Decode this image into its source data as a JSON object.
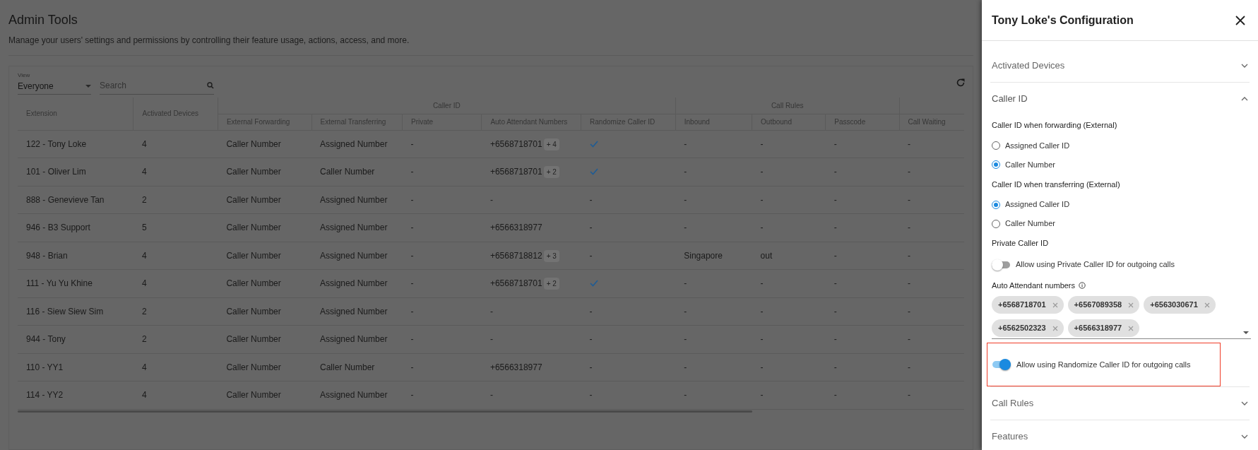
{
  "page": {
    "title": "Admin Tools",
    "subtitle": "Manage your users' settings and permissions by controlling their feature usage, actions, access, and more."
  },
  "filters": {
    "view_label": "View",
    "view_value": "Everyone",
    "search_placeholder": "Search"
  },
  "table": {
    "columns": [
      {
        "label": "Extension"
      },
      {
        "label": "Activated Devices"
      },
      {
        "group": "Caller ID",
        "colspan": 5,
        "children": [
          "External Forwarding",
          "External Transferring",
          "Private",
          "Auto Attendant Numbers",
          "Randomize Caller ID"
        ]
      },
      {
        "group": "Call Rules",
        "colspan": 3,
        "children": [
          "Inbound",
          "Outbound",
          "Passcode"
        ]
      },
      {
        "children": [
          "Call Waiting"
        ]
      }
    ],
    "rows": [
      {
        "cells": [
          "122 - Tony Loke",
          "4",
          "Caller Number",
          "Assigned Number",
          "-",
          {
            "number": "+6568718701",
            "extra": "+ 4"
          },
          {
            "checked": true
          },
          "-",
          "-",
          "-",
          "-"
        ]
      },
      {
        "cells": [
          "101 - Oliver Lim",
          "4",
          "Caller Number",
          "Caller Number",
          "-",
          {
            "number": "+6568718701",
            "extra": "+ 2"
          },
          {
            "checked": true
          },
          "-",
          "-",
          "-",
          "-"
        ]
      },
      {
        "cells": [
          "888 - Genevieve Tan",
          "2",
          "Caller Number",
          "Assigned Number",
          "-",
          "-",
          {
            "checked": false,
            "text": "-"
          },
          "-",
          "-",
          "-",
          "-"
        ]
      },
      {
        "cells": [
          "946 - B3 Support",
          "5",
          "Caller Number",
          "Assigned Number",
          "-",
          {
            "number": "+6566318977"
          },
          {
            "checked": false,
            "text": "-"
          },
          "-",
          "-",
          "-",
          "-"
        ]
      },
      {
        "cells": [
          "948 - Brian",
          "4",
          "Caller Number",
          "Assigned Number",
          "-",
          {
            "number": "+6568718812",
            "extra": "+ 3"
          },
          {
            "checked": false,
            "text": "-"
          },
          "Singapore",
          "out",
          "-",
          "-"
        ]
      },
      {
        "cells": [
          "111 - Yu Yu Khine",
          "4",
          "Caller Number",
          "Assigned Number",
          "-",
          {
            "number": "+6568718701",
            "extra": "+ 2"
          },
          {
            "checked": true
          },
          "-",
          "-",
          "-",
          "-"
        ]
      },
      {
        "cells": [
          "116 - Siew Siew Sim",
          "2",
          "Caller Number",
          "Assigned Number",
          "-",
          "-",
          {
            "checked": false,
            "text": "-"
          },
          "-",
          "-",
          "-",
          "-"
        ]
      },
      {
        "cells": [
          "944 - Tony",
          "2",
          "Caller Number",
          "Assigned Number",
          "-",
          "-",
          {
            "checked": false,
            "text": "-"
          },
          "-",
          "-",
          "-",
          "-"
        ]
      },
      {
        "cells": [
          "110 - YY1",
          "4",
          "Caller Number",
          "Caller Number",
          "-",
          {
            "number": "+6566318977"
          },
          {
            "checked": false,
            "text": "-"
          },
          "-",
          "-",
          "-",
          "-"
        ]
      },
      {
        "cells": [
          "114 - YY2",
          "4",
          "Caller Number",
          "Assigned Number",
          "-",
          "-",
          {
            "checked": false,
            "text": "-"
          },
          "-",
          "-",
          "-",
          "-"
        ]
      }
    ]
  },
  "panel": {
    "title": "Tony Loke's Configuration",
    "sections": [
      {
        "title": "Activated Devices",
        "expanded": false
      },
      {
        "title": "Caller ID",
        "expanded": true,
        "blocks": [
          {
            "kind": "radio",
            "heading": "Caller ID when forwarding (External)",
            "options": [
              {
                "label": "Assigned Caller ID",
                "selected": false
              },
              {
                "label": "Caller Number",
                "selected": true
              }
            ]
          },
          {
            "kind": "radio",
            "heading": "Caller ID when transferring (External)",
            "options": [
              {
                "label": "Assigned Caller ID",
                "selected": true
              },
              {
                "label": "Caller Number",
                "selected": false
              }
            ]
          },
          {
            "kind": "toggle",
            "heading": "Private Caller ID",
            "label": "Allow using Private Caller ID for outgoing calls",
            "on": false,
            "highlighted": false
          },
          {
            "kind": "chips",
            "heading": "Auto Attendant numbers",
            "chips": [
              "+6568718701",
              "+6567089358",
              "+6563030671",
              "+6562502323",
              "+6566318977"
            ]
          },
          {
            "kind": "toggle",
            "label": "Allow using Randomize Caller ID for outgoing calls",
            "on": true,
            "highlighted": true
          }
        ]
      },
      {
        "title": "Call Rules",
        "expanded": false
      },
      {
        "title": "Features",
        "expanded": false
      }
    ]
  }
}
